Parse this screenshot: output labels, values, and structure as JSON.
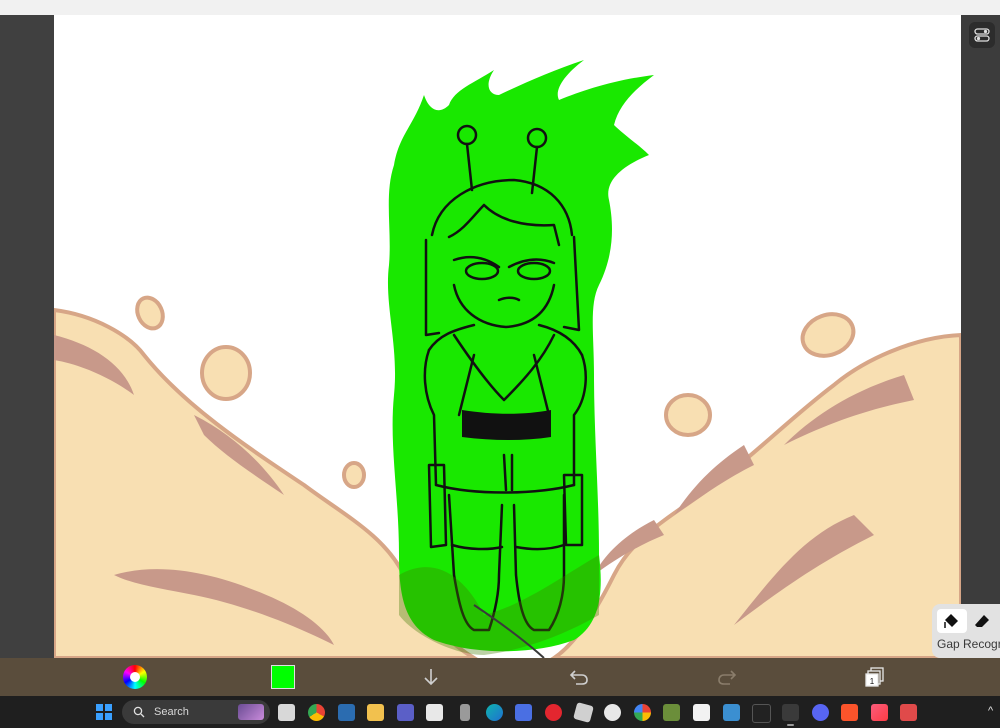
{
  "gap_recognition": {
    "label": "Gap Recogr"
  },
  "toolbar": {
    "current_color": "#00ff00",
    "layer_count": "1",
    "icons": [
      "color-wheel-icon",
      "color-swatch",
      "import-arrow-icon",
      "undo-icon",
      "redo-icon",
      "layers-icon"
    ]
  },
  "taskbar": {
    "search_placeholder": "Search",
    "apps": [
      "windows-start",
      "search",
      "task-view",
      "chrome",
      "news",
      "file-explorer",
      "teams",
      "store",
      "usb",
      "edge",
      "media-app",
      "opera",
      "roblox",
      "video-player",
      "google-photos",
      "minecraft",
      "amazon",
      "pinball",
      "apple-tv",
      "ibis-paint",
      "discord",
      "brave",
      "apple-music",
      "snipping-tool"
    ]
  },
  "colors": {
    "aura_green": "#19e800",
    "sand": "#f8dfb2",
    "sand_shadow": "#c8998a",
    "sand_outline": "#d7a687",
    "sidebar": "#404040"
  }
}
